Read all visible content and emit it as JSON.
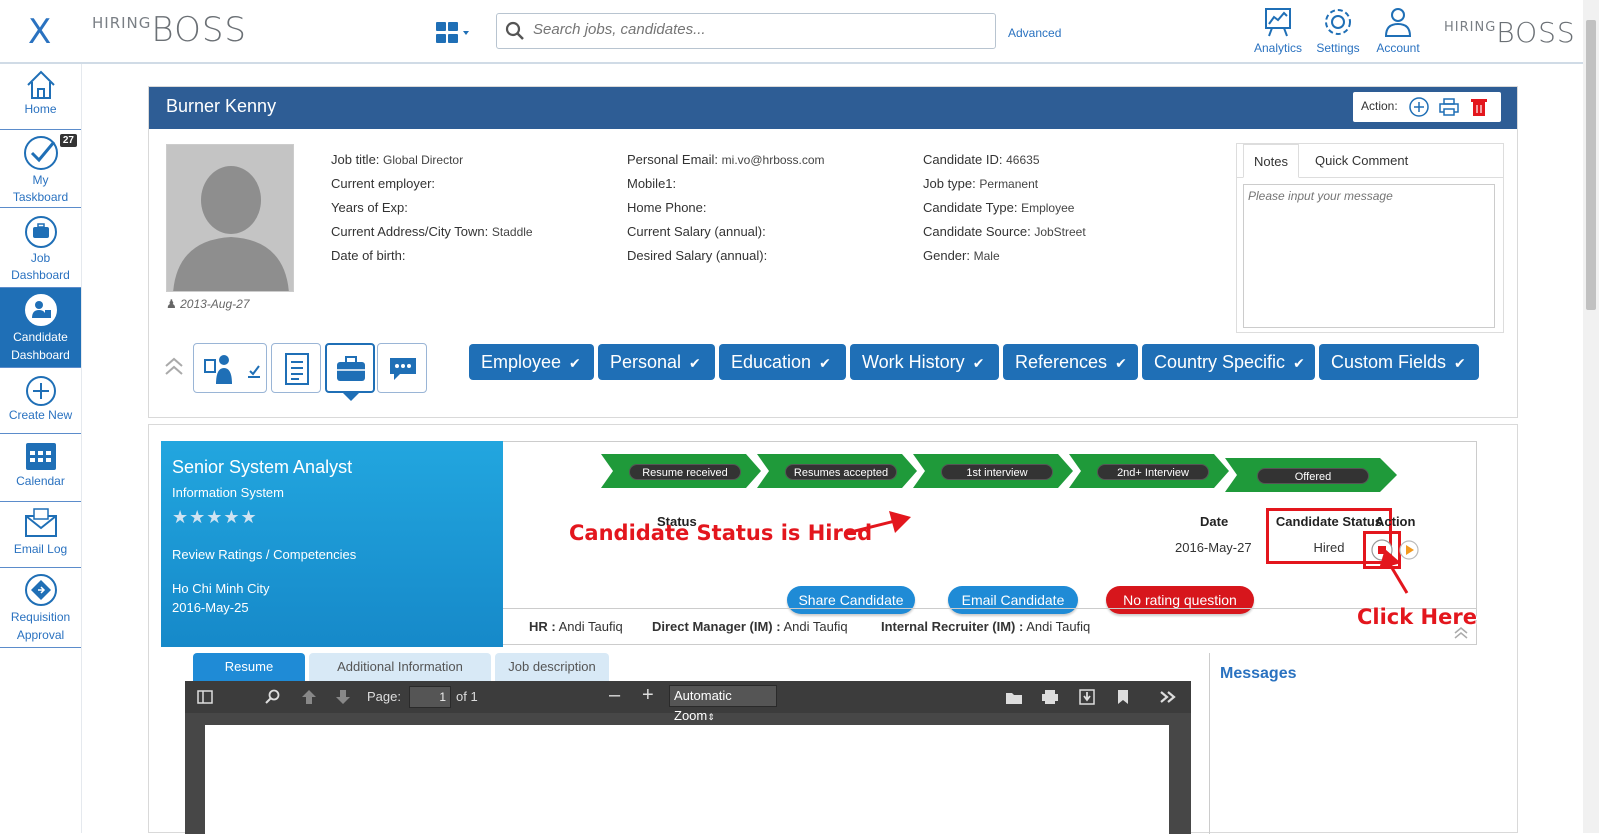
{
  "header": {
    "brand_small": "HIRING",
    "brand_big": "BOSS",
    "search_placeholder": "Search jobs, candidates...",
    "advanced_label": "Advanced",
    "analytics_label": "Analytics",
    "settings_label": "Settings",
    "account_label": "Account"
  },
  "sidebar": {
    "items": [
      {
        "label": "Home"
      },
      {
        "label": "My Taskboard",
        "badge": "27"
      },
      {
        "label": "Job Dashboard"
      },
      {
        "label": "Candidate Dashboard"
      },
      {
        "label": "Create New"
      },
      {
        "label": "Calendar"
      },
      {
        "label": "Email Log"
      },
      {
        "label": "Requisition Approval"
      }
    ]
  },
  "candidate": {
    "name": "Burner Kenny",
    "action_label": "Action:",
    "photo_date": "2013-Aug-27",
    "col1": [
      {
        "label": "Job title:",
        "value": "Global Director"
      },
      {
        "label": "Current employer:",
        "value": ""
      },
      {
        "label": "Years of Exp:",
        "value": ""
      },
      {
        "label": "Current Address/City Town:",
        "value": "Staddle"
      },
      {
        "label": "Date of birth:",
        "value": ""
      }
    ],
    "col2": [
      {
        "label": "Personal Email:",
        "value": "mi.vo@hrboss.com"
      },
      {
        "label": "Mobile1:",
        "value": ""
      },
      {
        "label": "Home Phone:",
        "value": ""
      },
      {
        "label": "Current Salary (annual):",
        "value": ""
      },
      {
        "label": "Desired Salary (annual):",
        "value": ""
      }
    ],
    "col3": [
      {
        "label": "Candidate ID:",
        "value": "46635"
      },
      {
        "label": "Job type:",
        "value": "Permanent"
      },
      {
        "label": "Candidate Type:",
        "value": "Employee"
      },
      {
        "label": "Candidate Source:",
        "value": "JobStreet"
      },
      {
        "label": "Gender:",
        "value": "Male"
      }
    ],
    "notes_tab": "Notes",
    "quick_comment_tab": "Quick Comment",
    "notes_placeholder": "Please input your message",
    "section_buttons": [
      "Employee",
      "Personal",
      "Education",
      "Work History",
      "References",
      "Country Specific",
      "Custom Fields"
    ]
  },
  "job": {
    "title": "Senior System Analyst",
    "department": "Information System",
    "stars": "★★★★★",
    "ratings_link": "Review Ratings / Competencies",
    "city": "Ho Chi Minh City",
    "date": "2016-May-25",
    "stages": [
      "Resume received",
      "Resumes accepted",
      "1st interview",
      "2nd+ Interview",
      "Offered"
    ],
    "col_status": "Status",
    "col_candidate_status": "Candidate Status",
    "col_date": "Date",
    "col_action": "Action",
    "candidate_status_value": "Hired",
    "status_date": "2016-May-27",
    "share_btn": "Share Candidate",
    "email_btn": "Email Candidate",
    "rating_btn": "No rating question",
    "hr_label": "HR :",
    "hr_value": "Andi Taufiq",
    "dm_label": "Direct Manager (IM) :",
    "dm_value": "Andi Taufiq",
    "ir_label": "Internal Recruiter (IM) :",
    "ir_value": "Andi Taufiq",
    "annotation_status": "Candidate Status is Hired",
    "annotation_click": "Click Here"
  },
  "documents": {
    "tabs": [
      "Resume",
      "Additional Information",
      "Job description"
    ],
    "page_label": "Page:",
    "page_value": "1",
    "page_of": "of 1",
    "zoom_value": "Automatic Zoom",
    "messages_title": "Messages"
  },
  "colors": {
    "primary": "#1f6fb6",
    "header_blue": "#2e5d95",
    "stage_green": "#1f9a3a",
    "annotation_red": "#e3161d"
  }
}
